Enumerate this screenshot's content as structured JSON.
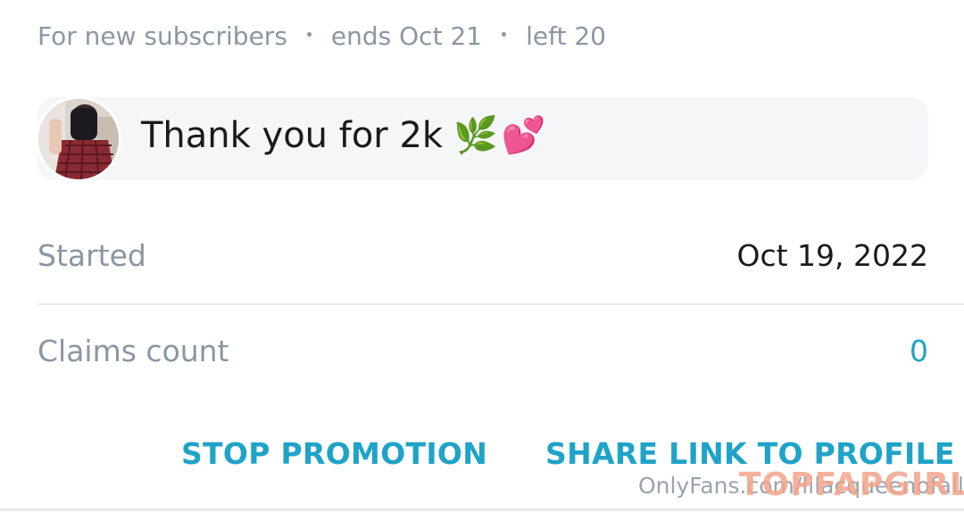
{
  "promo": {
    "audience": "For new subscribers",
    "ends": "ends Oct 21",
    "left": "left 20",
    "message": "Thank you for 2k",
    "emoji_leaf": "🌿",
    "emoji_hearts": "💕"
  },
  "details": {
    "started_label": "Started",
    "started_value": "Oct 19, 2022",
    "claims_label": "Claims count",
    "claims_value": "0"
  },
  "actions": {
    "stop_label": "STOP PROMOTION",
    "share_label": "SHARE LINK TO PROFILE"
  },
  "watermark": {
    "site_text": "OnlyFans.com/lilacqueenofalltrees",
    "logo_text": "TOPFAPGIRLS"
  },
  "colors": {
    "accent": "#1fa3c8",
    "muted_text": "#8a96a3",
    "message_bg": "#f4f6f8",
    "divider": "#e6e9ed"
  }
}
